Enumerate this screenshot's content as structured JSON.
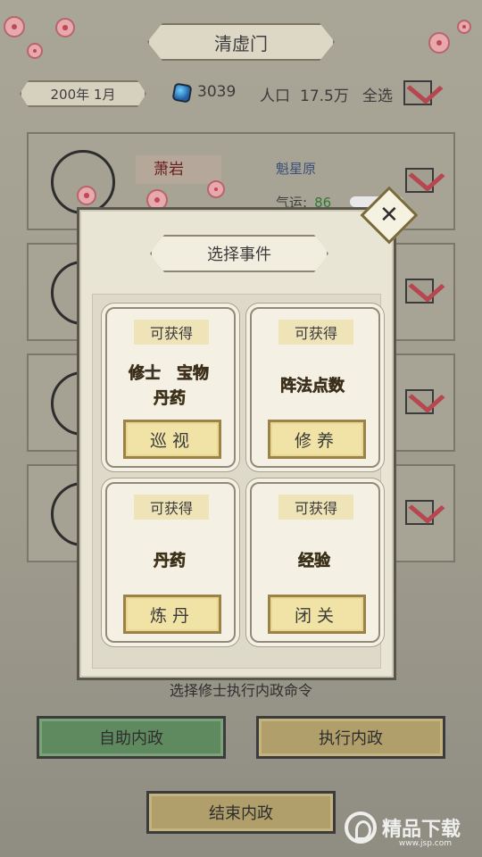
{
  "header": {
    "sect_name": "清虚门",
    "date": "200年 1月",
    "spirit_stones": "3039",
    "population_label": "人口",
    "population_value": "17.5万",
    "select_all_label": "全选"
  },
  "roster": [
    {
      "name": "萧岩",
      "realm": "魁星原",
      "luck_label": "气运:",
      "luck_value": "86"
    },
    {
      "name": "",
      "realm": "",
      "luck_label": "",
      "luck_value": ""
    },
    {
      "name": "",
      "realm": "",
      "luck_label": "",
      "luck_value": ""
    },
    {
      "name": "",
      "realm": "",
      "luck_label": "",
      "luck_value": ""
    }
  ],
  "modal": {
    "title": "选择事件",
    "close_symbol": "✕",
    "events": [
      {
        "header": "可获得",
        "rewards": [
          "修士",
          "宝物",
          "丹药"
        ],
        "action": "巡视"
      },
      {
        "header": "可获得",
        "rewards": [
          "阵法点数"
        ],
        "action": "修养"
      },
      {
        "header": "可获得",
        "rewards": [
          "丹药"
        ],
        "action": "炼丹"
      },
      {
        "header": "可获得",
        "rewards": [
          "经验"
        ],
        "action": "闭关"
      }
    ]
  },
  "footer": {
    "hint": "选择修士执行内政命令",
    "auto_button": "自助内政",
    "execute_button": "执行内政",
    "end_button": "结束内政"
  },
  "watermark": {
    "text": "精品下载",
    "sub": "www.jsp.com"
  },
  "colors": {
    "reward_blue": "#3b78d8",
    "reward_red": "#d6454a",
    "reward_gold": "#d4a21f",
    "reward_purple": "#8a5cd6",
    "reward_green": "#4f9f3a",
    "check_red": "#b6464f"
  }
}
